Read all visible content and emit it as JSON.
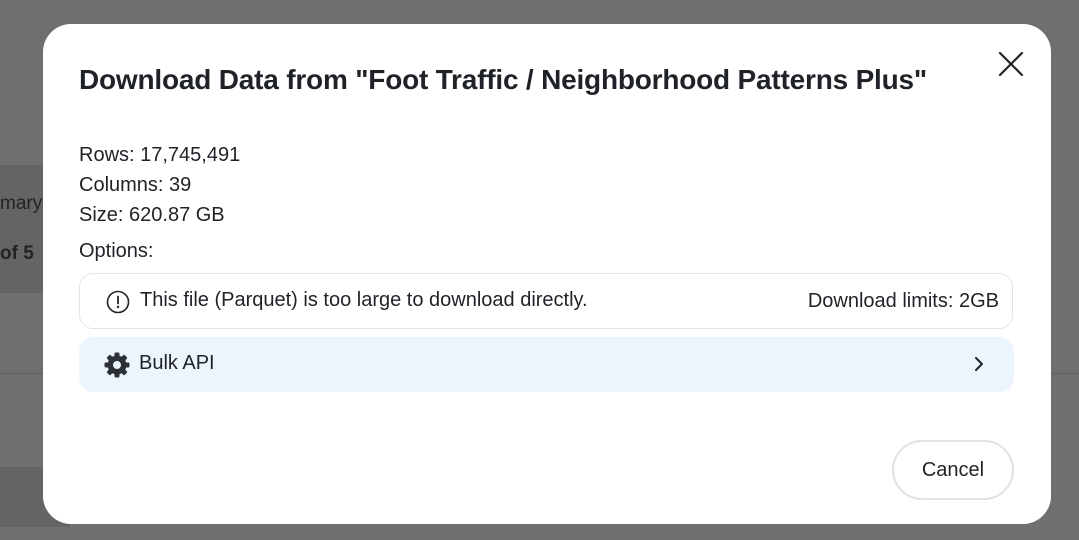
{
  "background": {
    "summary_fragment": "mary",
    "pager_fragment": "of 5"
  },
  "modal": {
    "title": "Download Data from \"Foot Traffic / Neighborhood Patterns Plus\"",
    "close_icon": "close-icon",
    "rows_line": "Rows: 17,745,491",
    "columns_line": "Columns: 39",
    "size_line": "Size: 620.87 GB",
    "options_label": "Options:",
    "notice": {
      "icon": "exclamation-circle-icon",
      "message": "This file (Parquet) is too large to download directly.",
      "limit": "Download limits: 2GB"
    },
    "bulk_api": {
      "icon": "gear-icon",
      "label": "Bulk API",
      "chevron": "chevron-right-icon"
    },
    "cancel_label": "Cancel"
  },
  "colors": {
    "overlay": "#6f6f6f",
    "modal_bg": "#ffffff",
    "text": "#1f2328",
    "bulk_api_bg": "#ecf5fd",
    "border": "#e3e5e8"
  }
}
